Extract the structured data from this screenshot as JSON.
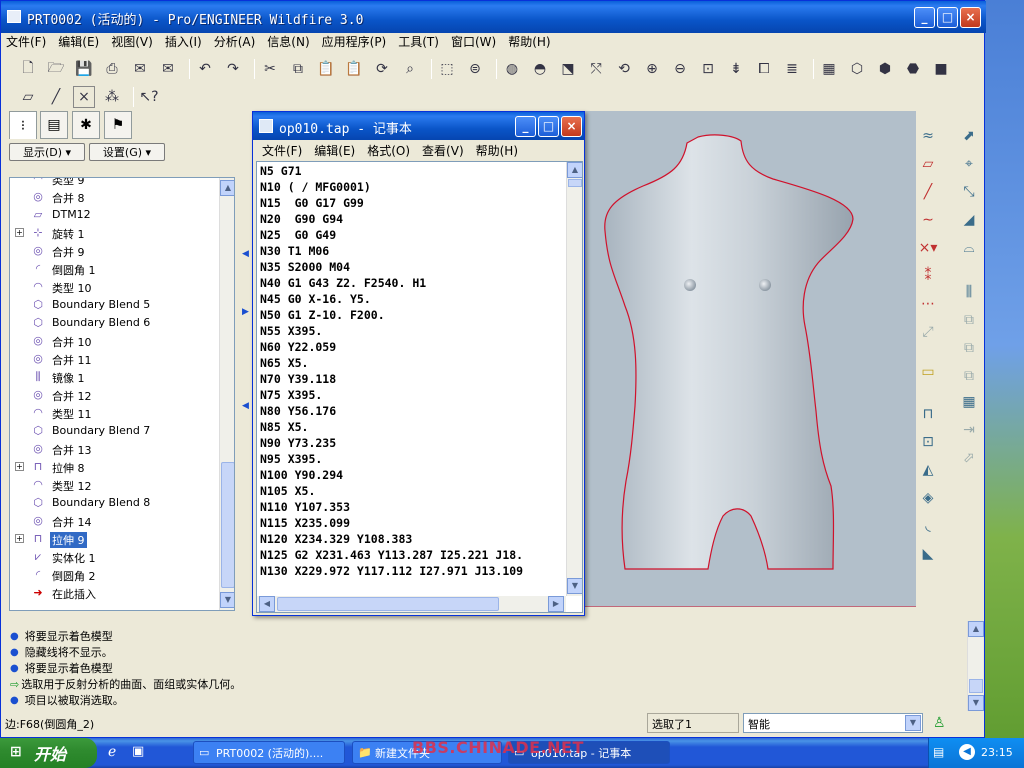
{
  "main_window": {
    "title": "PRT0002 (活动的) - Pro/ENGINEER Wildfire 3.0",
    "menu": [
      "文件(F)",
      "编辑(E)",
      "视图(V)",
      "插入(I)",
      "分析(A)",
      "信息(N)",
      "应用程序(P)",
      "工具(T)",
      "窗口(W)",
      "帮助(H)"
    ]
  },
  "toolbar_icons": [
    "new-icon",
    "open-icon",
    "save-icon",
    "print-icon",
    "mail-icon",
    "mail-recipient-icon",
    "undo-icon",
    "redo-icon",
    "cut-icon",
    "copy-icon",
    "paste-icon",
    "paste-special-icon",
    "regenerate-icon",
    "find-icon",
    "select-box-icon",
    "layer-icon",
    "appearance-icon",
    "render-icon",
    "sketch-view-icon",
    "spin-center-icon",
    "orient-icon",
    "zoom-in-icon",
    "zoom-out-icon",
    "refit-icon",
    "reorient-icon",
    "saved-views-icon",
    "layers-icon",
    "model-display-icon",
    "wireframe-icon",
    "hidden-line-icon",
    "no-hidden-icon",
    "shading-icon"
  ],
  "model_tree": {
    "show_label": "显示(D)",
    "settings_label": "设置(G)",
    "items": [
      {
        "label": "类型 9",
        "icon": "surface-icon",
        "expand": false,
        "selected": false
      },
      {
        "label": "合并 8",
        "icon": "merge-icon",
        "expand": false,
        "selected": false
      },
      {
        "label": "DTM12",
        "icon": "datum-plane-icon",
        "expand": false,
        "selected": false
      },
      {
        "label": "旋转 1",
        "icon": "revolve-icon",
        "expand": true,
        "selected": false
      },
      {
        "label": "合并 9",
        "icon": "merge-icon",
        "expand": false,
        "selected": false
      },
      {
        "label": "倒圆角 1",
        "icon": "round-icon",
        "expand": false,
        "selected": false
      },
      {
        "label": "类型 10",
        "icon": "surface-icon",
        "expand": false,
        "selected": false
      },
      {
        "label": "Boundary Blend 5",
        "icon": "boundary-blend-icon",
        "expand": false,
        "selected": false
      },
      {
        "label": "Boundary Blend 6",
        "icon": "boundary-blend-icon",
        "expand": false,
        "selected": false
      },
      {
        "label": "合并 10",
        "icon": "merge-icon",
        "expand": false,
        "selected": false
      },
      {
        "label": "合并 11",
        "icon": "merge-icon",
        "expand": false,
        "selected": false
      },
      {
        "label": "镜像 1",
        "icon": "mirror-icon",
        "expand": false,
        "selected": false
      },
      {
        "label": "合并 12",
        "icon": "merge-icon",
        "expand": false,
        "selected": false
      },
      {
        "label": "类型 11",
        "icon": "surface-icon",
        "expand": false,
        "selected": false
      },
      {
        "label": "Boundary Blend 7",
        "icon": "boundary-blend-icon",
        "expand": false,
        "selected": false
      },
      {
        "label": "合并 13",
        "icon": "merge-icon",
        "expand": false,
        "selected": false
      },
      {
        "label": "拉伸 8",
        "icon": "extrude-icon",
        "expand": true,
        "selected": false
      },
      {
        "label": "类型 12",
        "icon": "surface-icon",
        "expand": false,
        "selected": false
      },
      {
        "label": "Boundary Blend 8",
        "icon": "boundary-blend-icon",
        "expand": false,
        "selected": false
      },
      {
        "label": "合并 14",
        "icon": "merge-icon",
        "expand": false,
        "selected": false
      },
      {
        "label": "拉伸 9",
        "icon": "extrude-icon",
        "expand": true,
        "selected": true
      },
      {
        "label": "实体化 1",
        "icon": "solidify-icon",
        "expand": false,
        "selected": false
      },
      {
        "label": "倒圆角 2",
        "icon": "round-icon",
        "expand": false,
        "selected": false
      },
      {
        "label": "在此插入",
        "icon": "insert-here-arrow-icon",
        "expand": false,
        "selected": false
      }
    ]
  },
  "notepad": {
    "title": "op010.tap - 记事本",
    "menu": [
      "文件(F)",
      "编辑(E)",
      "格式(O)",
      "查看(V)",
      "帮助(H)"
    ],
    "lines": [
      "N5 G71",
      "N10 ( / MFG0001)",
      "N15  G0 G17 G99",
      "N20  G90 G94",
      "N25  G0 G49",
      "N30 T1 M06",
      "N35 S2000 M04",
      "N40 G1 G43 Z2. F2540. H1",
      "N45 G0 X-16. Y5.",
      "N50 G1 Z-10. F200.",
      "N55 X395.",
      "N60 Y22.059",
      "N65 X5.",
      "N70 Y39.118",
      "N75 X395.",
      "N80 Y56.176",
      "N85 X5.",
      "N90 Y73.235",
      "N95 X395.",
      "N100 Y90.294",
      "N105 X5.",
      "N110 Y107.353",
      "N115 X235.099",
      "N120 X234.329 Y108.383",
      "N125 G2 X231.463 Y113.287 I25.221 J18.",
      "N130 X229.972 Y117.112 I27.971 J13.109"
    ]
  },
  "messages": [
    {
      "bullet": "info",
      "text": "将要显示着色模型"
    },
    {
      "bullet": "info",
      "text": "隐藏线将不显示。"
    },
    {
      "bullet": "info",
      "text": "将要显示着色模型"
    },
    {
      "bullet": "prompt",
      "text": "选取用于反射分析的曲面、面组或实体几何。"
    },
    {
      "bullet": "info",
      "text": "项目以被取消选取。"
    }
  ],
  "status": {
    "edge_text": "边:F68(倒圆角_2)",
    "selected_text": "选取了1",
    "filter_value": "智能"
  },
  "taskbar": {
    "start_label": "开始",
    "tasks": [
      "PRT0002 (活动的)....",
      "新建文件夹",
      "op010.tap - 记事本"
    ],
    "watermark": "BBS.CHINADE.NET",
    "clock": "23:15"
  },
  "colors": {
    "title_blue": "#0a5fd8",
    "graphics_bg": "#b2bfca",
    "silhouette_edge": "#d0112b",
    "model_surface": "#c3cdd6",
    "selection": "#316ac5"
  }
}
